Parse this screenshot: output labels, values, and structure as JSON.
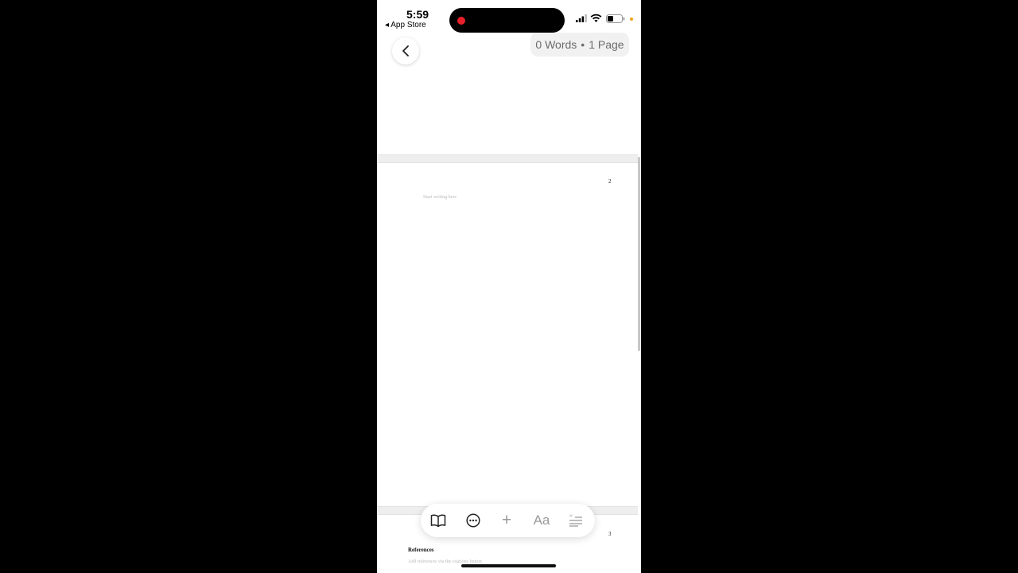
{
  "status_bar": {
    "time": "5:59",
    "back_to_app": "◂ App Store"
  },
  "header": {
    "word_count": "0 Words",
    "separator": "•",
    "page_count": "1 Page"
  },
  "document": {
    "page2_number": "2",
    "page2_placeholder": "Start writing here",
    "page3_number": "3",
    "references_heading": "References",
    "references_placeholder": "Add references via the citations button"
  },
  "toolbar": {
    "font_label": "Aa",
    "add_label": "+",
    "icons": [
      "book-icon",
      "more-icon",
      "add-icon",
      "font-icon",
      "citation-icon"
    ]
  },
  "colors": {
    "background": "#000000",
    "screen": "#ffffff",
    "pill": "#f1f1f1",
    "recording": "#e8202a"
  }
}
